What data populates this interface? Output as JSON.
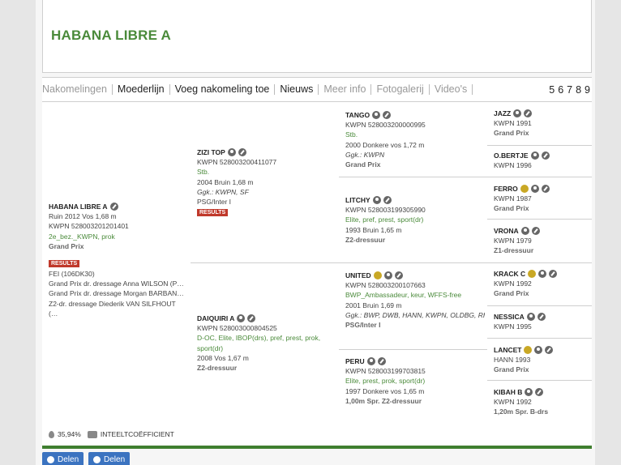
{
  "header": {
    "title": "HABANA LIBRE A"
  },
  "nav": {
    "tabs": [
      "Nakomelingen",
      "Moederlijn",
      "Voeg nakomeling toe",
      "Nieuws",
      "Meer info",
      "Fotogalerij",
      "Video's"
    ],
    "pages": [
      "5",
      "6",
      "7",
      "8",
      "9"
    ]
  },
  "subject": {
    "name": "HABANA LIBRE A",
    "line1": "Ruin 2012 Vos 1,68 m",
    "line2": "KWPN 528003201201401",
    "line3": "2e_bez._KWPN, prok",
    "line4": "Grand Prix",
    "results_label": "RESULTS",
    "fei": "FEI (106DK30)",
    "res1": "Grand Prix dr. dressage Anna WILSON (P…",
    "res2": "Grand Prix dr. dressage Morgan BARBAN…",
    "res3": "Z2-dr. dressage Diederik VAN SILFHOUT (…"
  },
  "sire": {
    "name": "ZIZI TOP",
    "reg": "KWPN 528003200411077",
    "stb": "Stb.",
    "born": "2004 Bruin 1,68 m",
    "ggk": "Ggk.: KWPN, SF",
    "level": "PSG/Inter I",
    "results_label": "RESULTS"
  },
  "dam": {
    "name": "DAIQUIRI A",
    "reg": "KWPN 528003000804525",
    "pred1": "D-OC, Elite, IBOP(drs), pref, prest, prok,",
    "pred2": "sport(dr)",
    "born": "2008 Vos 1,67 m",
    "level": "Z2-dressuur"
  },
  "gp": {
    "tango": {
      "name": "TANGO",
      "reg": "KWPN 528003200000995",
      "stb": "Stb.",
      "born": "2000 Donkere vos 1,72 m",
      "ggk": "Ggk.: KWPN",
      "level": "Grand Prix"
    },
    "litchy": {
      "name": "LITCHY",
      "reg": "KWPN 528003199305990",
      "pred": "Elite, pref, prest, sport(dr)",
      "born": "1993 Bruin 1,65 m",
      "level": "Z2-dressuur"
    },
    "united": {
      "name": "UNITED",
      "reg": "KWPN 528003200107663",
      "pred": "BWP_Ambassadeur, keur, WFFS-free",
      "born": "2001 Bruin 1,69 m",
      "ggk": "Ggk.: BWP, DWB, HANN, KWPN, OLDBG, RHE…",
      "level": "PSG/Inter I"
    },
    "peru": {
      "name": "PERU",
      "reg": "KWPN 528003199703815",
      "pred": "Elite, prest, prok, sport(dr)",
      "born": "1997 Donkere vos 1,65 m",
      "level": "1,00m Spr. Z2-dressuur"
    }
  },
  "ggp": {
    "jazz": {
      "name": "JAZZ",
      "reg": "KWPN 1991",
      "level": "Grand Prix"
    },
    "obertje": {
      "name": "O.BERTJE",
      "reg": "KWPN 1996"
    },
    "ferro": {
      "name": "FERRO",
      "reg": "KWPN 1987",
      "level": "Grand Prix"
    },
    "vrona": {
      "name": "VRONA",
      "reg": "KWPN 1979",
      "level": "Z1-dressuur"
    },
    "krackc": {
      "name": "KRACK C",
      "reg": "KWPN 1992",
      "level": "Grand Prix"
    },
    "nessica": {
      "name": "NESSICA",
      "reg": "KWPN 1995"
    },
    "lancet": {
      "name": "LANCET",
      "reg": "HANN 1993",
      "level": "Grand Prix"
    },
    "kibahb": {
      "name": "KIBAH B",
      "reg": "KWPN 1992",
      "level": "1,20m Spr. B-drs"
    }
  },
  "footer": {
    "inbreeding_pct": "35,94%",
    "inbreeding_label": "INTEELTCOËFFICIENT",
    "share1": "Delen",
    "share2": "Delen"
  }
}
